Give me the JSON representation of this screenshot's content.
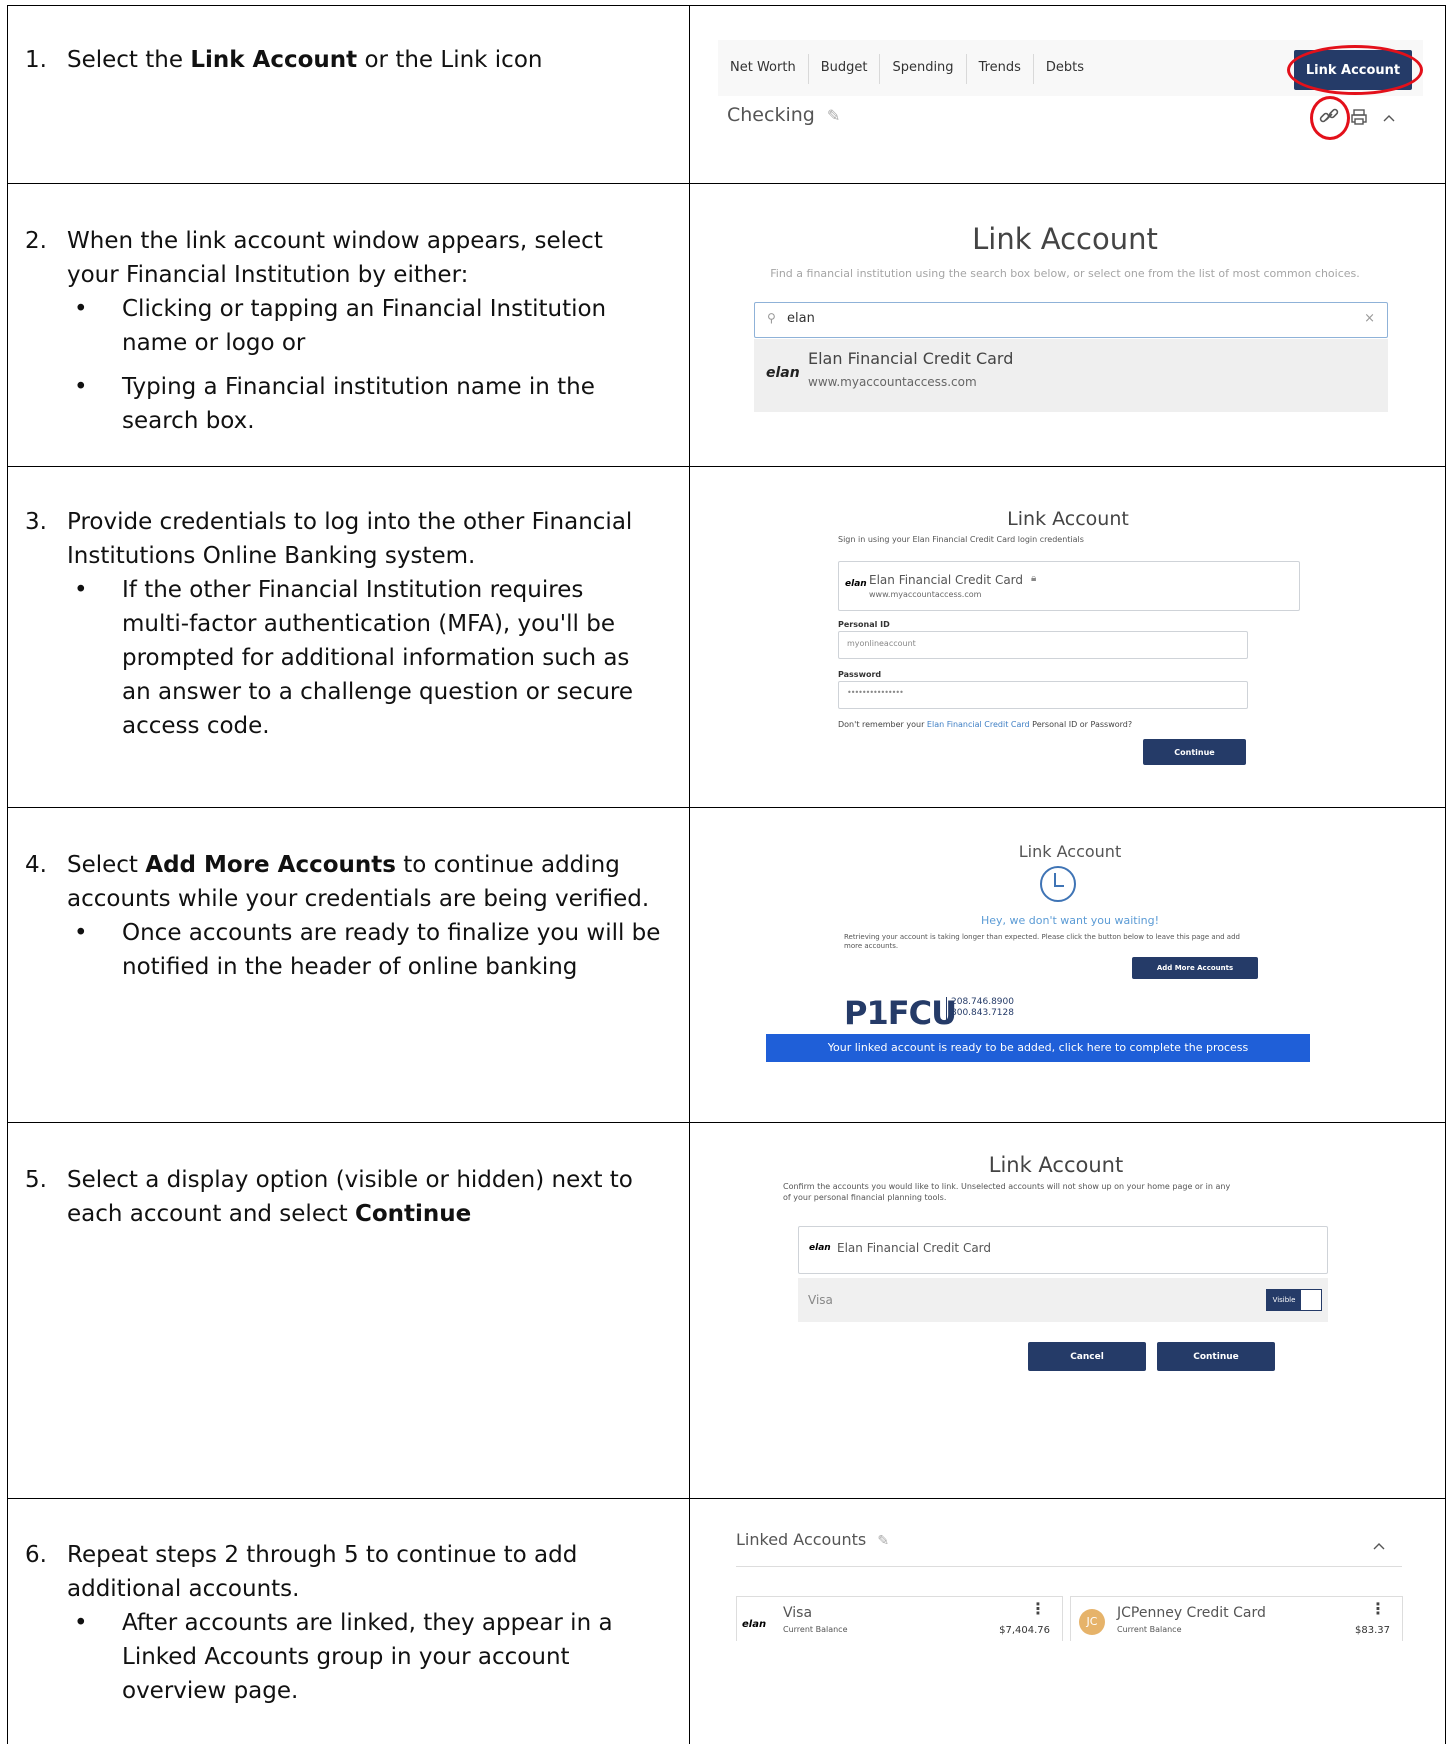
{
  "steps": [
    {
      "num": "1.",
      "lines": [
        "Select the |Link Account| or the Link icon"
      ],
      "pre": "Select the ",
      "bold": "Link Account",
      "post": " or the Link icon"
    },
    {
      "num": "2.",
      "line1": "When the link account window appears, select",
      "line2": "your Financial Institution by either:",
      "bullets": [
        [
          "Clicking or tapping an Financial Institution",
          "name or logo or"
        ],
        [
          "Typing a Financial institution name in the",
          "search box."
        ]
      ]
    },
    {
      "num": "3.",
      "line1": "Provide credentials to log into the other Financial",
      "line2": "Institutions Online Banking system.",
      "bullets": [
        [
          "If the other Financial Institution requires",
          "multi-factor authentication (MFA), you'll be",
          "prompted for additional information such as",
          "an answer to a challenge question or secure",
          "access code."
        ]
      ]
    },
    {
      "num": "4.",
      "pre": "Select ",
      "bold": "Add More Accounts",
      "post": " to continue adding",
      "line2": "accounts while your credentials are being verified.",
      "bullets": [
        [
          "Once accounts are ready to finalize you will be",
          "notified in the header of online banking"
        ]
      ]
    },
    {
      "num": "5.",
      "line1": "Select a display option (visible or hidden) next to",
      "pre": "each account and select ",
      "bold": "Continue"
    },
    {
      "num": "6.",
      "line1": "Repeat steps 2 through 5 to continue to add",
      "line2": "additional accounts.",
      "bullets": [
        [
          "After accounts are linked, they appear in a",
          "Linked Accounts group in your account",
          "overview page."
        ]
      ]
    }
  ],
  "shot1": {
    "tabs": [
      "Net Worth",
      "Budget",
      "Spending",
      "Trends",
      "Debts"
    ],
    "link_button": "Link Account",
    "section_title": "Checking"
  },
  "shot2": {
    "title": "Link Account",
    "subtitle": "Find a financial institution using the search box below, or select one from the list of most common choices.",
    "search_value": "elan",
    "result_logo": "elan",
    "result_name": "Elan Financial Credit Card",
    "result_url": "www.myaccountaccess.com"
  },
  "shot3": {
    "title": "Link Account",
    "subtitle": "Sign in using your Elan Financial Credit Card login credentials",
    "logo": "elan",
    "fi_name": "Elan Financial Credit Card",
    "fi_url": "www.myaccountaccess.com",
    "id_label": "Personal ID",
    "id_value": "myonlineaccount",
    "pw_label": "Password",
    "pw_value": "•••••••••••••••",
    "forgot_pre": "Don't remember your ",
    "forgot_link": "Elan Financial Credit Card",
    "forgot_post": " Personal ID or Password?",
    "continue": "Continue"
  },
  "shot4": {
    "title": "Link Account",
    "headline": "Hey, we don't want you waiting!",
    "body1": "Retrieving your account is taking longer than expected. Please click the button below to leave this page and add",
    "body2": "more accounts.",
    "button": "Add More Accounts",
    "brand": "P1FCU",
    "phone1": "208.746.8900",
    "phone2": "800.843.7128",
    "banner": "Your linked account is ready to be added, click here to complete the process"
  },
  "shot5": {
    "title": "Link Account",
    "subtitle1": "Confirm the accounts you would like to link. Unselected accounts will not show up on your home page or in any",
    "subtitle2": "of your personal financial planning tools.",
    "logo": "elan",
    "fi_name": "Elan Financial Credit Card",
    "account": "Visa",
    "toggle": "Visible",
    "cancel": "Cancel",
    "continue": "Continue"
  },
  "shot6": {
    "title": "Linked Accounts",
    "cards": [
      {
        "logo": "elan",
        "name": "Visa",
        "label": "Current Balance",
        "amount": "$7,404.76"
      },
      {
        "logo": "JC",
        "name": "JCPenney Credit Card",
        "label": "Current Balance",
        "amount": "$83.37"
      }
    ]
  }
}
